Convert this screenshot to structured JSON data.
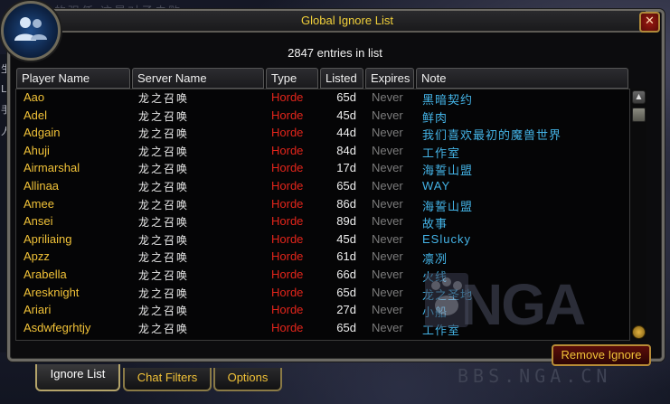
{
  "background": {
    "text": "的强任  这是对子击败"
  },
  "left_strip": [
    "生",
    "L",
    "手",
    "人"
  ],
  "window": {
    "title": "Global Ignore List",
    "close_label": "✕",
    "entries_count_text": "2847 entries in list"
  },
  "columns": [
    "Player Name",
    "Server Name",
    "Type",
    "Listed",
    "Expires",
    "Note"
  ],
  "rows": [
    {
      "name": "Aao",
      "server": "龙之召唤",
      "type": "Horde",
      "listed": "65d",
      "expires": "Never",
      "note": "黑暗契约"
    },
    {
      "name": "Adel",
      "server": "龙之召唤",
      "type": "Horde",
      "listed": "45d",
      "expires": "Never",
      "note": "鲜肉"
    },
    {
      "name": "Adgain",
      "server": "龙之召唤",
      "type": "Horde",
      "listed": "44d",
      "expires": "Never",
      "note": "我们喜欢最初的魔兽世界"
    },
    {
      "name": "Ahuji",
      "server": "龙之召唤",
      "type": "Horde",
      "listed": "84d",
      "expires": "Never",
      "note": "工作室"
    },
    {
      "name": "Airmarshal",
      "server": "龙之召唤",
      "type": "Horde",
      "listed": "17d",
      "expires": "Never",
      "note": "海誓山盟"
    },
    {
      "name": "Allinaa",
      "server": "龙之召唤",
      "type": "Horde",
      "listed": "65d",
      "expires": "Never",
      "note": "WAY"
    },
    {
      "name": "Amee",
      "server": "龙之召唤",
      "type": "Horde",
      "listed": "86d",
      "expires": "Never",
      "note": "海誓山盟"
    },
    {
      "name": "Ansei",
      "server": "龙之召唤",
      "type": "Horde",
      "listed": "89d",
      "expires": "Never",
      "note": "故事"
    },
    {
      "name": "Apriliaing",
      "server": "龙之召唤",
      "type": "Horde",
      "listed": "45d",
      "expires": "Never",
      "note": "ESlucky"
    },
    {
      "name": "Apzz",
      "server": "龙之召唤",
      "type": "Horde",
      "listed": "61d",
      "expires": "Never",
      "note": "凛冽"
    },
    {
      "name": "Arabella",
      "server": "龙之召唤",
      "type": "Horde",
      "listed": "66d",
      "expires": "Never",
      "note": "火线"
    },
    {
      "name": "Aresknight",
      "server": "龙之召唤",
      "type": "Horde",
      "listed": "65d",
      "expires": "Never",
      "note": "龙之圣地"
    },
    {
      "name": "Ariari",
      "server": "龙之召唤",
      "type": "Horde",
      "listed": "27d",
      "expires": "Never",
      "note": "小船"
    },
    {
      "name": "Asdwfegrhtjy",
      "server": "龙之召唤",
      "type": "Horde",
      "listed": "65d",
      "expires": "Never",
      "note": "工作室"
    }
  ],
  "buttons": {
    "remove_ignore": "Remove Ignore"
  },
  "tabs": [
    "Ignore List",
    "Chat Filters",
    "Options"
  ],
  "watermark": {
    "logo": "NGA",
    "url": "BBS.NGA.CN"
  },
  "colors": {
    "title": "#f1d03a",
    "name": "#f1c238",
    "horde": "#e4251b",
    "note": "#44b3e6",
    "expires": "#7c7c7c"
  }
}
